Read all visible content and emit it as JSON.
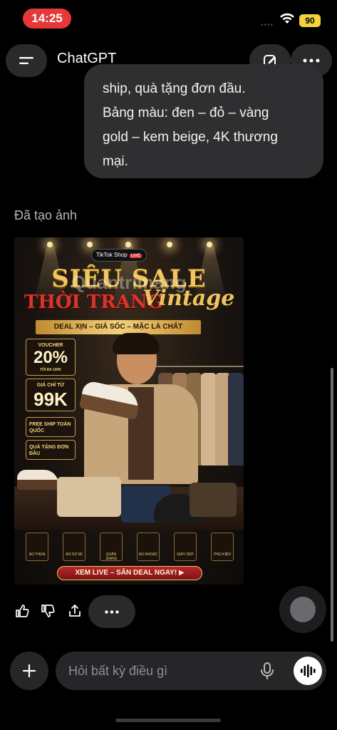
{
  "status_bar": {
    "time": "14:25",
    "battery": "90"
  },
  "header": {
    "title": "ChatGPT"
  },
  "user_message": {
    "lines": [
      "ship, quà tặng đơn đầu.",
      "Bảng màu: đen – đỏ – vàng",
      "gold – kem beige, 4K thương",
      "mại."
    ]
  },
  "generated_label": "Đã tạo ảnh",
  "poster": {
    "badge_brand": "TikTok Shop",
    "badge_live": "LIVE",
    "title_1": "SIÊU SALE",
    "title_2": "THỜI TRANG",
    "title_3": "Vintage",
    "subtitle": "DEAL XỊN – GIÁ SỐC – MẶC LÀ CHẤT",
    "voucher_label": "VOUCHER",
    "voucher_value": "20%",
    "voucher_note": "TỐI ĐA 100K",
    "price_label": "GIÁ CHỈ TỪ",
    "price_value": "99K",
    "free_ship": "FREE SHIP TOÀN QUỐC",
    "gift": "QUÀ TẶNG ĐƠN ĐẦU",
    "categories": [
      "ÁO THUN",
      "ÁO SƠ MI",
      "QUẦN JEANS",
      "ÁO KHOÁC",
      "GIÀY DÉP",
      "PHỤ KIỆN"
    ],
    "cta": "XEM LIVE – SĂN DEAL NGAY! ▶",
    "watermark": "Quantrimang"
  },
  "composer": {
    "placeholder": "Hỏi bất kỳ điều gì"
  },
  "colors": {
    "accent_red": "#e5383b",
    "gold": "#f1c65a",
    "bubble": "#2f2f31"
  }
}
